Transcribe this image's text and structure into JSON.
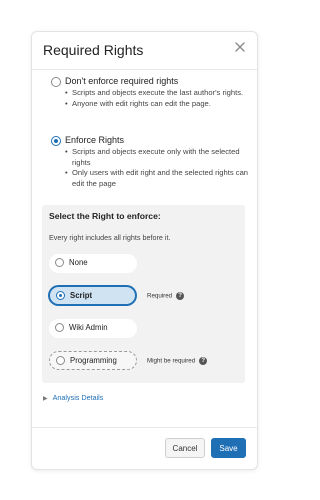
{
  "dialog": {
    "title": "Required Rights",
    "close_icon": "close-icon"
  },
  "options": [
    {
      "label": "Don't enforce required rights",
      "checked": false,
      "bullets": [
        "Scripts and objects execute the last author's rights.",
        "Anyone with edit rights can edit the page."
      ]
    },
    {
      "label": "Enforce Rights",
      "checked": true,
      "bullets": [
        "Scripts and objects execute only with the selected rights",
        "Only users with edit right and the selected rights can edit the page"
      ]
    }
  ],
  "panel": {
    "title": "Select the Right to enforce:",
    "subtitle": "Every right includes all rights before it.",
    "rights": [
      {
        "label": "None",
        "selected": false,
        "note": ""
      },
      {
        "label": "Script",
        "selected": true,
        "note": "Required"
      },
      {
        "label": "Wiki Admin",
        "selected": false,
        "note": ""
      },
      {
        "label": "Programming",
        "selected": false,
        "note": "Might be required"
      }
    ]
  },
  "analysis_details": "Analysis Details",
  "buttons": {
    "cancel": "Cancel",
    "save": "Save"
  },
  "colors": {
    "accent": "#1f6fb5",
    "selected_bg": "#cfe3f2",
    "panel_bg": "#f2f2f2"
  }
}
